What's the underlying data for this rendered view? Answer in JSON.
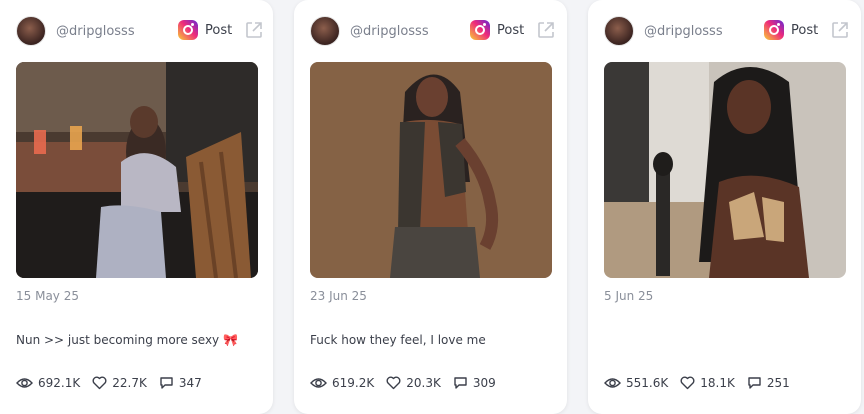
{
  "posts": [
    {
      "handle": "@dripglosss",
      "platform": "Post",
      "date": "15 May 25",
      "caption": "Nun >> just becoming more sexy",
      "caption_emoji": "🎀",
      "views": "692.1K",
      "likes": "22.7K",
      "comments": "347"
    },
    {
      "handle": "@dripglosss",
      "platform": "Post",
      "date": "23 Jun 25",
      "caption": "Fuck how they feel, I love me",
      "views": "619.2K",
      "likes": "20.3K",
      "comments": "309"
    },
    {
      "handle": "@dripglosss",
      "platform": "Post",
      "date": "5 Jun 25",
      "caption": "",
      "views": "551.6K",
      "likes": "18.1K",
      "comments": "251"
    }
  ],
  "icons": {
    "platform": "instagram-icon",
    "external": "external-link-icon",
    "views": "eye-icon",
    "likes": "heart-icon",
    "comments": "comment-icon"
  },
  "colors": {
    "background": "#f3f4f7",
    "card": "#ffffff",
    "muted_text": "#8a8f9a"
  }
}
